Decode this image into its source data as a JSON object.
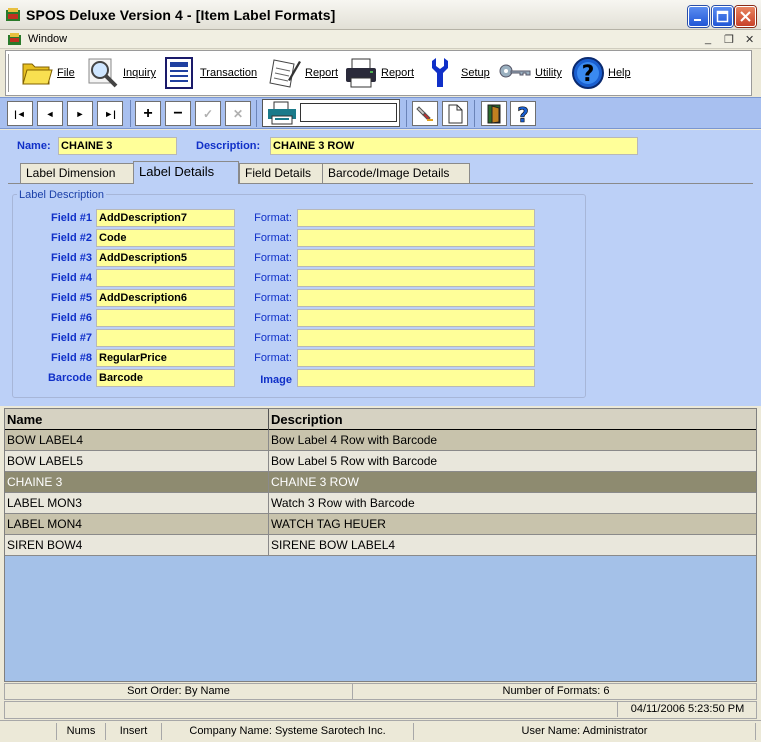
{
  "window": {
    "title": "SPOS Deluxe Version 4 - [Item Label Formats]",
    "menu_window": "Window"
  },
  "toolbar": {
    "items": [
      {
        "label": "File",
        "icon": "folder-icon"
      },
      {
        "label": "Inquiry",
        "icon": "magnifier-icon"
      },
      {
        "label": "Transaction",
        "icon": "document-list-icon"
      },
      {
        "label": "Report",
        "icon": "pen-paper-icon"
      },
      {
        "label": "Report",
        "icon": "printer-icon"
      },
      {
        "label": "Setup",
        "icon": "wrench-icon"
      },
      {
        "label": "Utility",
        "icon": "keys-icon"
      },
      {
        "label": "Help",
        "icon": "help-icon"
      }
    ]
  },
  "nav": {
    "first": "|◄",
    "prev": "◄",
    "next": "►",
    "last": "►|",
    "add": "+",
    "remove": "−",
    "save": "✓",
    "cancel": "✕",
    "printer_value": ""
  },
  "form": {
    "name_label": "Name:",
    "name_value": "CHAINE 3",
    "description_label": "Description:",
    "description_value": "CHAINE 3 ROW"
  },
  "tabs": [
    {
      "label": "Label Dimension"
    },
    {
      "label": "Label Details"
    },
    {
      "label": "Field Details"
    },
    {
      "label": "Barcode/Image Details"
    }
  ],
  "label_description": {
    "group_title": "Label Description",
    "format_label": "Format:",
    "image_label": "Image",
    "fields": [
      {
        "label": "Field #1",
        "value": "AddDescription7",
        "format": ""
      },
      {
        "label": "Field #2",
        "value": "Code",
        "format": ""
      },
      {
        "label": "Field #3",
        "value": "AddDescription5",
        "format": ""
      },
      {
        "label": "Field #4",
        "value": "",
        "format": ""
      },
      {
        "label": "Field #5",
        "value": "AddDescription6",
        "format": ""
      },
      {
        "label": "Field #6",
        "value": "",
        "format": ""
      },
      {
        "label": "Field #7",
        "value": "",
        "format": ""
      },
      {
        "label": "Field #8",
        "value": "RegularPrice",
        "format": ""
      }
    ],
    "barcode_label": "Barcode",
    "barcode_value": "Barcode",
    "image_value": ""
  },
  "grid": {
    "columns": [
      "Name",
      "Description"
    ],
    "rows": [
      {
        "name": "BOW LABEL4",
        "description": "Bow Label 4 Row with Barcode"
      },
      {
        "name": "BOW LABEL5",
        "description": "Bow Label 5 Row  with Barcode"
      },
      {
        "name": "CHAINE 3",
        "description": "CHAINE 3 ROW"
      },
      {
        "name": "LABEL MON3",
        "description": "Watch 3 Row with Barcode"
      },
      {
        "name": "LABEL MON4",
        "description": "WATCH TAG HEUER"
      },
      {
        "name": "SIREN BOW4",
        "description": "SIRENE BOW LABEL4"
      }
    ],
    "selected_index": 2
  },
  "status": {
    "sort_order": "Sort Order: By Name",
    "num_formats": "Number of Formats: 6",
    "datetime": "04/11/2006  5:23:50 PM",
    "nums": "Nums",
    "insert": "Insert",
    "company": "Company Name: Systeme Sarotech Inc.",
    "user": "User Name: Administrator"
  },
  "colors": {
    "form_bg": "#bcd0f7",
    "field_yellow": "#ffff99",
    "label_blue": "#1030c8",
    "selected_row": "#8e8b70"
  }
}
